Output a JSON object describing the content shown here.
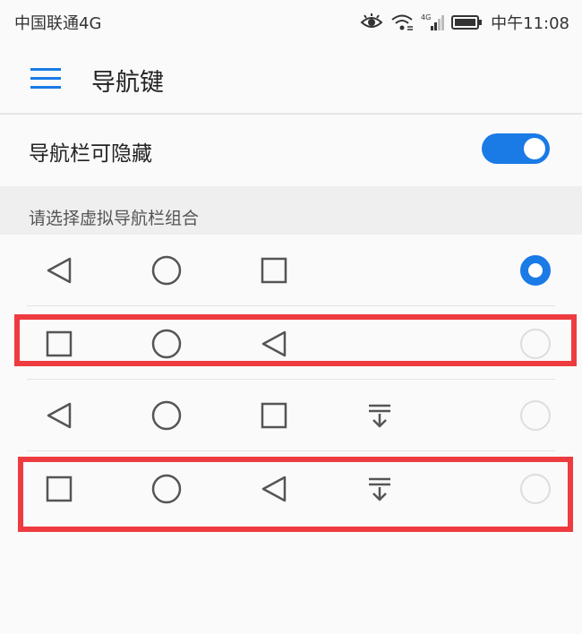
{
  "status_bar": {
    "carrier": "中国联通4G",
    "network_badge": "4G",
    "time": "中午11:08"
  },
  "header": {
    "title": "导航键",
    "menu_icon": "hamburger-menu-icon"
  },
  "settings": {
    "hide_nav_label": "导航栏可隐藏",
    "hide_nav_enabled": true
  },
  "section": {
    "title": "请选择虚拟导航栏组合"
  },
  "options": [
    {
      "keys": [
        "back-icon",
        "home-icon",
        "recent-icon"
      ],
      "selected": true
    },
    {
      "keys": [
        "recent-icon",
        "home-icon",
        "back-icon"
      ],
      "selected": false
    },
    {
      "keys": [
        "back-icon",
        "home-icon",
        "recent-icon",
        "notification-pulldown-icon"
      ],
      "selected": false
    },
    {
      "keys": [
        "recent-icon",
        "home-icon",
        "back-icon",
        "notification-pulldown-icon"
      ],
      "selected": false
    }
  ],
  "colors": {
    "accent": "#1a7ae6",
    "highlight": "#ee3b3f",
    "icon_stroke": "#555555"
  }
}
